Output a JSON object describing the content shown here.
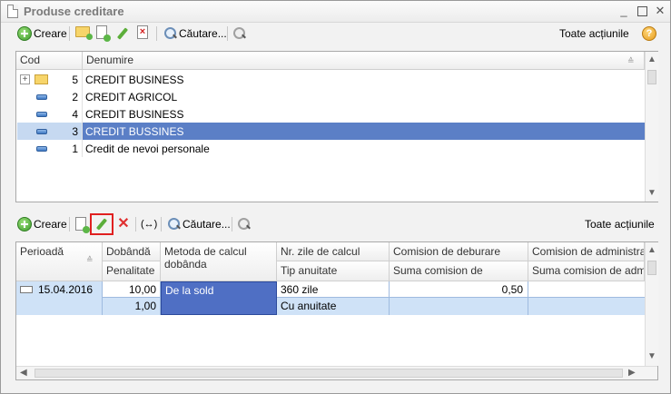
{
  "window": {
    "title": "Produse creditare"
  },
  "top_toolbar": {
    "create_label": "Creare",
    "search_label": "Căutare...",
    "all_actions_label": "Toate acțiunile"
  },
  "products_table": {
    "columns": [
      "Cod",
      "Denumire"
    ],
    "rows": [
      {
        "code": "5",
        "name": "CREDIT BUSINESS",
        "type": "folder",
        "selected": false
      },
      {
        "code": "2",
        "name": "CREDIT AGRICOL",
        "type": "item",
        "selected": false
      },
      {
        "code": "4",
        "name": "CREDIT BUSINESS",
        "type": "item",
        "selected": false
      },
      {
        "code": "3",
        "name": "CREDIT BUSSINES",
        "type": "item",
        "selected": true
      },
      {
        "code": "1",
        "name": "Credit de nevoi personale",
        "type": "item",
        "selected": false
      }
    ]
  },
  "bottom_toolbar": {
    "create_label": "Creare",
    "search_label": "Căutare...",
    "all_actions_label": "Toate acțiunile",
    "move_label": "(↔)"
  },
  "terms_table": {
    "headers": {
      "period": "Perioadă",
      "interest": "Dobândă",
      "penalty": "Penalitate",
      "method": "Metoda de calcul dobânda",
      "days": "Nr. zile de calcul",
      "annuity_type": "Tip anuitate",
      "disb_fee": "Comision de deburare",
      "disb_fee_sum": "Suma comision de deburare",
      "admin_fee": "Comision de administrare",
      "admin_fee_sum": "Suma comision de adminis"
    },
    "row": {
      "period": "15.04.2016",
      "interest": "10,00",
      "penalty": "1,00",
      "method": "De la sold",
      "days": "360 zile",
      "annuity_type": "Cu anuitate",
      "disb_fee": "0,50",
      "disb_fee_sum": "",
      "admin_fee": "",
      "admin_fee_sum": ""
    }
  },
  "colors": {
    "selection": "#5b7fc6",
    "row_highlight": "#cfe2f7",
    "method_cell": "#4f6fc4",
    "active_button_border": "#e02020"
  }
}
